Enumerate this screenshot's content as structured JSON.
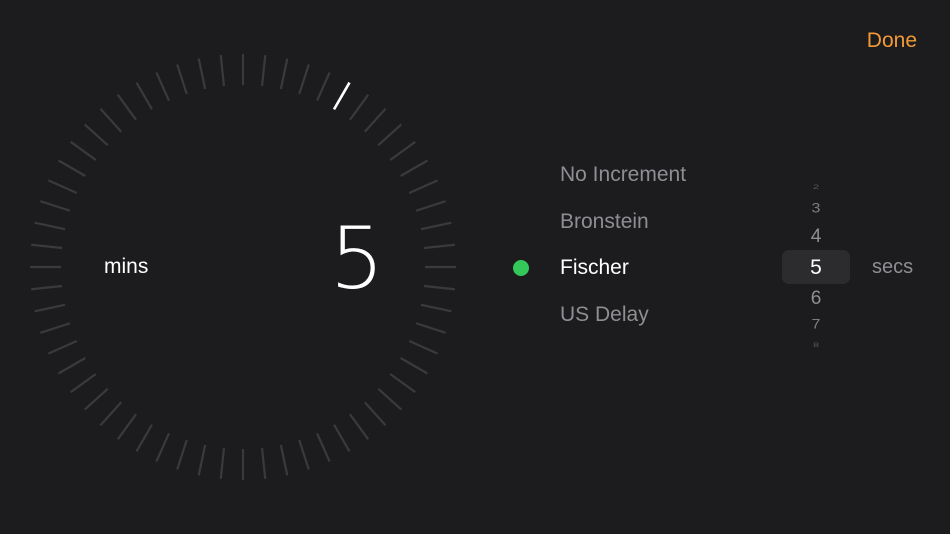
{
  "toolbar": {
    "done_label": "Done"
  },
  "dial": {
    "unit_label": "mins",
    "value": "5",
    "selected_minutes": 5,
    "tick_count": 60,
    "tick_color": "#3a3a3c",
    "active_tick_color": "#ffffff"
  },
  "increment_modes": [
    {
      "label": "No Increment",
      "selected": false
    },
    {
      "label": "Bronstein",
      "selected": false
    },
    {
      "label": "Fischer",
      "selected": true
    },
    {
      "label": "US Delay",
      "selected": false
    }
  ],
  "seconds_picker": {
    "unit_label": "secs",
    "options": [
      "2",
      "3",
      "4",
      "5",
      "6",
      "7",
      "8"
    ],
    "selected": "5"
  },
  "colors": {
    "accent": "#f09a37",
    "selected_dot": "#34c759",
    "background": "#1c1c1e"
  }
}
